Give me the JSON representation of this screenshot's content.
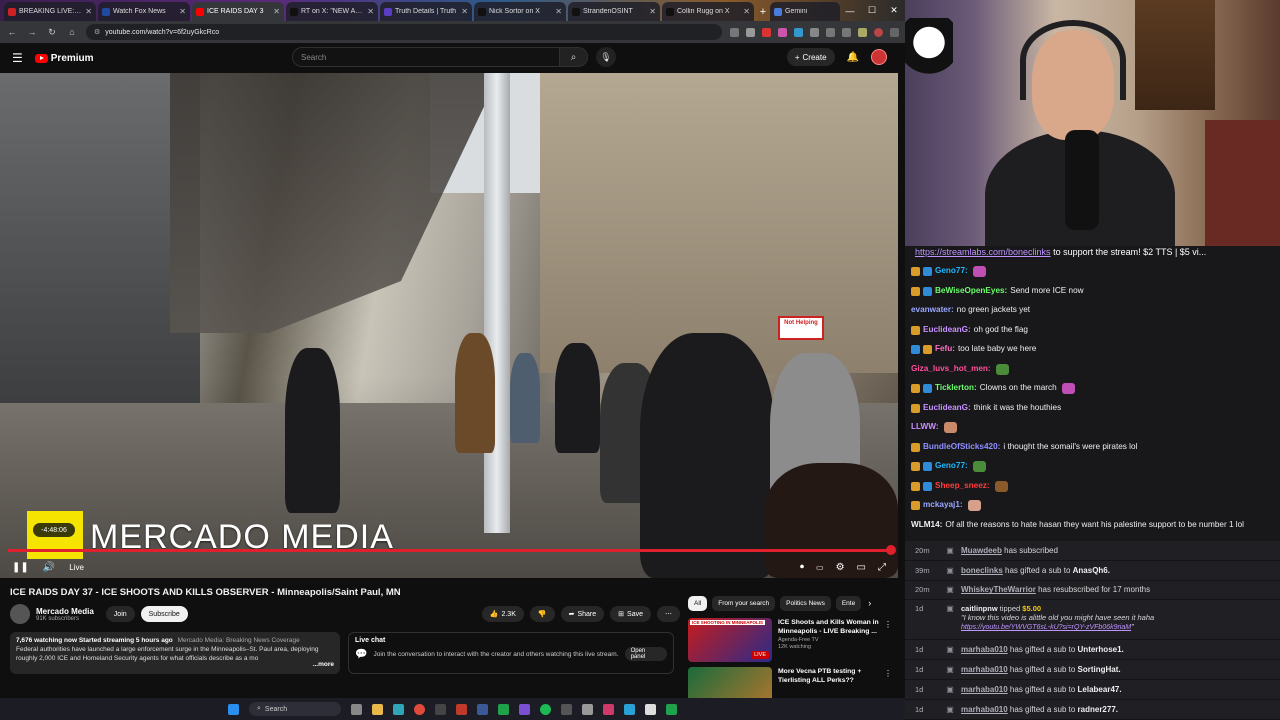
{
  "browser": {
    "tabs": [
      {
        "label": "BREAKING LIVE: ICE",
        "color": "#cc2222",
        "active": false
      },
      {
        "label": "Watch Fox News",
        "color": "#1f4aa0",
        "active": false
      },
      {
        "label": "ICE RAIDS DAY 3",
        "color": "#ff0000",
        "active": true
      },
      {
        "label": "RT on X: \"NEW ANG",
        "color": "#111111",
        "active": false
      },
      {
        "label": "Truth Details | Truth",
        "color": "#5b3cc4",
        "active": false
      },
      {
        "label": "Nick Sortor on X",
        "color": "#111111",
        "active": false
      },
      {
        "label": "StrandenOSINT",
        "color": "#111111",
        "active": false
      },
      {
        "label": "Collin Rugg on X",
        "color": "#111111",
        "active": false
      }
    ],
    "gemini_tab": "Gemini",
    "url": "youtube.com/watch?v=6f2uyGkcRco"
  },
  "youtube": {
    "logo_text": "Premium",
    "search_placeholder": "Search",
    "create_label": "Create"
  },
  "video": {
    "overlay_title": "MERCADO MEDIA",
    "time_bubble": "-4:48:06",
    "live_label": "Live",
    "sign_text": "Not Helping",
    "progress_fraction": 1.0
  },
  "details": {
    "title": "ICE RAIDS DAY 37 - ICE SHOOTS AND KILLS OBSERVER - Minneapolis/Saint Paul, MN",
    "channel_name": "Mercado Media",
    "channel_subs": "91K subscribers",
    "join_label": "Join",
    "subscribe_label": "Subscribe",
    "likes": "2.3K",
    "share_label": "Share",
    "save_label": "Save",
    "desc_watching": "7,676 watching now  Started streaming 5 hours ago",
    "desc_channel": "Mercado Media: Breaking News Coverage",
    "desc_text": "Federal authorities have launched a large enforcement surge in the Minneapolis–St. Paul area, deploying roughly 2,000 ICE and Homeland Security agents for what officials describe as a mo",
    "desc_more": "...more",
    "livechat_title": "Live chat",
    "livechat_text": "Join the conversation to interact with the creator and others watching this live stream.",
    "open_panel_label": "Open panel"
  },
  "recommendations": {
    "chips": [
      "All",
      "From your search",
      "Politics News",
      "Ente"
    ],
    "items": [
      {
        "title": "ICE Shoots and Kills Woman in Minneapolis - LIVE Breaking ...",
        "channel": "Agenda-Free TV",
        "meta": "12K watching",
        "tag": "ICE SHOOTING IN MINNEAPOLIS",
        "live": "LIVE"
      },
      {
        "title": "More Vecna PTB testing + Tierlisting ALL Perks??",
        "channel": "",
        "meta": "",
        "tag": "",
        "live": ""
      }
    ]
  },
  "taskbar": {
    "search_label": "Search"
  },
  "chat": {
    "banner_link": "https://streamlabs.com/boneclinks",
    "banner_text": " to support the stream! $2 TTS | $5 vi...",
    "messages": [
      {
        "user": "Geno77:",
        "color": "#1fb8ff",
        "text": "",
        "badges": [
          "#d99b2a",
          "#2f8bd8"
        ],
        "emote": "#c04fb5"
      },
      {
        "user": "BeWiseOpenEyes:",
        "color": "#6bff6b",
        "text": "Send more ICE now",
        "badges": [
          "#d99b2a",
          "#2f8bd8"
        ],
        "emote": ""
      },
      {
        "user": "evanwater:",
        "color": "#9aa6ff",
        "text": "no green jackets yet",
        "badges": [],
        "emote": ""
      },
      {
        "user": "EuclideanG:",
        "color": "#c892ff",
        "text": "oh god the flag",
        "badges": [
          "#d99b2a"
        ],
        "emote": ""
      },
      {
        "user": "Fefu:",
        "color": "#ff6ec7",
        "text": "too late baby we here",
        "badges": [
          "#2f8bd8",
          "#d99b2a"
        ],
        "emote": ""
      },
      {
        "user": "Giza_luvs_hot_men:",
        "color": "#ff4f9a",
        "text": "",
        "badges": [],
        "emote": "#4a8c3a"
      },
      {
        "user": "Ticklerton:",
        "color": "#6bff6b",
        "text": "Clowns on the march",
        "badges": [
          "#d99b2a",
          "#2f8bd8"
        ],
        "emote": "#c04fb5"
      },
      {
        "user": "EuclideanG:",
        "color": "#c892ff",
        "text": "think it was the houthies",
        "badges": [
          "#d99b2a"
        ],
        "emote": ""
      },
      {
        "user": "LLWW:",
        "color": "#c892ff",
        "text": "",
        "badges": [],
        "emote": "#c98a6a"
      },
      {
        "user": "BundleOfSticks420:",
        "color": "#8f8fff",
        "text": "i thought the somail's were pirates lol",
        "badges": [
          "#d99b2a"
        ],
        "emote": ""
      },
      {
        "user": "Geno77:",
        "color": "#1fb8ff",
        "text": "",
        "badges": [
          "#d99b2a",
          "#2f8bd8"
        ],
        "emote": "#4a8c3a"
      },
      {
        "user": "Sheep_sneez:",
        "color": "#ff3b3b",
        "text": "",
        "badges": [
          "#d99b2a",
          "#2f8bd8"
        ],
        "emote": "#8a5a2a"
      },
      {
        "user": "mckayaj1:",
        "color": "#9aa6ff",
        "text": "",
        "badges": [
          "#d99b2a"
        ],
        "emote": "#d6a08a"
      },
      {
        "user": "WLM14:",
        "color": "#efeff1",
        "text": "Of all the reasons to hate hasan they want his palestine support to be number 1 lol",
        "badges": [],
        "emote": ""
      }
    ],
    "events": [
      {
        "time": "20m",
        "user": "Muawdeeb",
        "text": " has subscribed",
        "user2": "",
        "text2": ""
      },
      {
        "time": "39m",
        "user": "boneclinks",
        "text": " has gifted a sub to ",
        "user2": "AnasQh6.",
        "text2": ""
      },
      {
        "time": "20m",
        "user": "WhiskeyTheWarrior",
        "text": " has resubscribed for 17 months",
        "user2": "",
        "text2": ""
      },
      {
        "time": "1d",
        "user": "marhaba010",
        "text": " has gifted a sub to ",
        "user2": "Unterhose1.",
        "text2": ""
      },
      {
        "time": "1d",
        "user": "marhaba010",
        "text": " has gifted a sub to ",
        "user2": "SortingHat.",
        "text2": ""
      },
      {
        "time": "1d",
        "user": "marhaba010",
        "text": " has gifted a sub to ",
        "user2": "Lelabear47.",
        "text2": ""
      },
      {
        "time": "1d",
        "user": "marhaba010",
        "text": " has gifted a sub to ",
        "user2": "radner277.",
        "text2": ""
      }
    ],
    "tip": {
      "time": "1d",
      "user": "caitlinpnw",
      "text": " tipped ",
      "amount": "$5.00",
      "message": "\"I know this video is alittle old you might have seen it haha",
      "url": "https://youtu.be/YWVGT6sL-kU?si=rQY-zVFb06k9riaM",
      "url_end": "\""
    }
  }
}
